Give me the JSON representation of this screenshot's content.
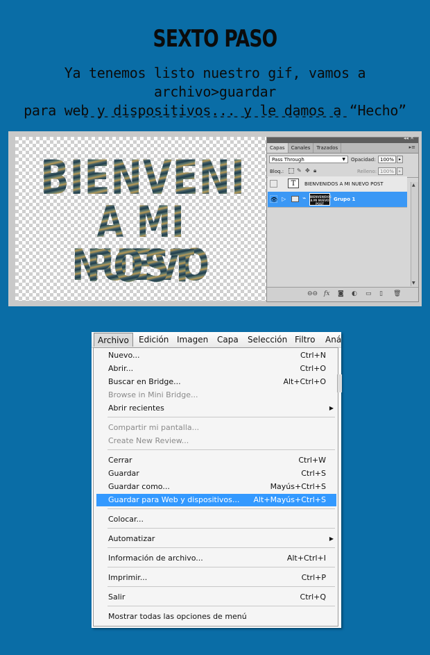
{
  "header": {
    "title": "SEXTO PASO",
    "subtitle_line1": "Ya tenemos listo nuestro gif, vamos a archivo>guardar",
    "subtitle_line2": "para web y dispositivos... y le damos a “Hecho”",
    "separator": "---------------------------------------"
  },
  "canvas": {
    "line1": "BIENVENIDOS",
    "line2": "A MI NUEVO",
    "line3": "POST"
  },
  "layers_panel": {
    "tabs": [
      "Capas",
      "Canales",
      "Trazados"
    ],
    "blend_mode": "Pass Through",
    "opacity_label": "Opacidad:",
    "opacity_value": "100%",
    "lock_label": "Bloq.:",
    "fill_label": "Relleno:",
    "fill_value": "100%",
    "layers": [
      {
        "name": "BIENVENIDOS A MI NUEVO POST",
        "type": "text",
        "selected": false
      },
      {
        "name": "Grupo 1",
        "type": "group",
        "selected": true
      }
    ],
    "group_thumb_text": "BIENVENIDOS A MI NUEVO POST"
  },
  "menubar": {
    "items": [
      "Archivo",
      "Edición",
      "Imagen",
      "Capa",
      "Selección",
      "Filtro",
      "Aná"
    ]
  },
  "file_menu": {
    "items": [
      {
        "label": "Nuevo...",
        "shortcut": "Ctrl+N"
      },
      {
        "label": "Abrir...",
        "shortcut": "Ctrl+O"
      },
      {
        "label": "Buscar en Bridge...",
        "shortcut": "Alt+Ctrl+O"
      },
      {
        "label": "Browse in Mini Bridge...",
        "shortcut": "",
        "disabled": true
      },
      {
        "label": "Abrir recientes",
        "shortcut": "",
        "submenu": true
      },
      {
        "label": "Compartir mi pantalla...",
        "shortcut": "",
        "disabled": true
      },
      {
        "label": "Create New Review...",
        "shortcut": "",
        "disabled": true
      },
      {
        "label": "Cerrar",
        "shortcut": "Ctrl+W"
      },
      {
        "label": "Guardar",
        "shortcut": "Ctrl+S"
      },
      {
        "label": "Guardar como...",
        "shortcut": "Mayús+Ctrl+S"
      },
      {
        "label": "Guardar para Web y dispositivos...",
        "shortcut": "Alt+Mayús+Ctrl+S",
        "highlighted": true
      },
      {
        "label": "Colocar...",
        "shortcut": ""
      },
      {
        "label": "Automatizar",
        "shortcut": "",
        "submenu": true
      },
      {
        "label": "Información de archivo...",
        "shortcut": "Alt+Ctrl+I"
      },
      {
        "label": "Imprimir...",
        "shortcut": "Ctrl+P"
      },
      {
        "label": "Salir",
        "shortcut": "Ctrl+Q"
      },
      {
        "label": "Mostrar todas las opciones de menú",
        "shortcut": ""
      }
    ]
  },
  "colors": {
    "background": "#0a6da6",
    "highlight": "#3399ff",
    "layer_selected": "#3b98f5"
  }
}
